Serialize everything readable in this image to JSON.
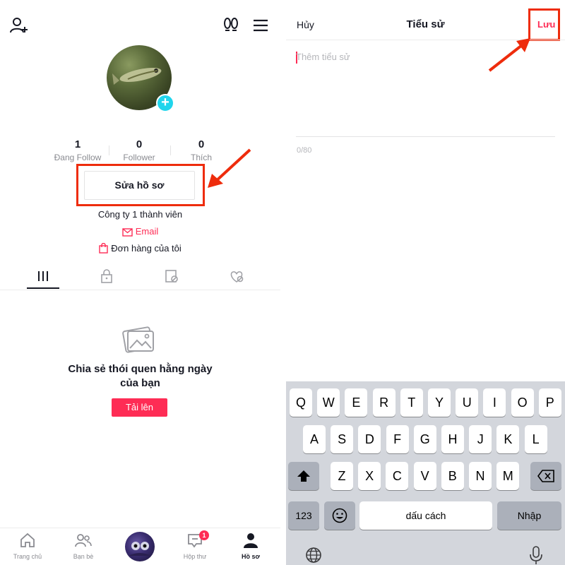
{
  "profile": {
    "stats": [
      {
        "value": "1",
        "label": "Đang Follow"
      },
      {
        "value": "0",
        "label": "Follower"
      },
      {
        "value": "0",
        "label": "Thích"
      }
    ],
    "edit_profile_label": "Sửa hồ sơ",
    "company": "Công ty 1 thành viên",
    "email_label": "Email",
    "orders_label": "Đơn hàng của tôi",
    "empty_title_line1": "Chia sẻ thói quen hằng ngày",
    "empty_title_line2": "của bạn",
    "upload_label": "Tải lên",
    "icons": [
      "add-friend-icon",
      "footprint-icon",
      "menu-icon",
      "grid-icon",
      "lock-icon",
      "tagged-icon",
      "liked-icon",
      "photo-icon"
    ]
  },
  "bottom_nav": {
    "items": [
      {
        "label": "Trang chủ",
        "icon": "home-icon"
      },
      {
        "label": "Bạn bè",
        "icon": "friends-icon"
      },
      {
        "label": "Hộp thư",
        "icon": "inbox-icon",
        "badge": "1"
      },
      {
        "label": "Hồ sơ",
        "icon": "profile-icon",
        "active": true
      }
    ]
  },
  "bio_editor": {
    "cancel_label": "Hủy",
    "title": "Tiểu sử",
    "save_label": "Lưu",
    "placeholder": "Thêm tiểu sử",
    "char_count": "0/80"
  },
  "keyboard": {
    "row1": [
      "Q",
      "W",
      "E",
      "R",
      "T",
      "Y",
      "U",
      "I",
      "O",
      "P"
    ],
    "row2": [
      "A",
      "S",
      "D",
      "F",
      "G",
      "H",
      "J",
      "K",
      "L"
    ],
    "row3": [
      "Z",
      "X",
      "C",
      "V",
      "B",
      "N",
      "M"
    ],
    "num_label": "123",
    "space_label": "dấu cách",
    "return_label": "Nhập"
  },
  "colors": {
    "accent": "#fe2c55",
    "highlight": "#ee2c0c",
    "avatar_badge": "#20d5ec"
  }
}
